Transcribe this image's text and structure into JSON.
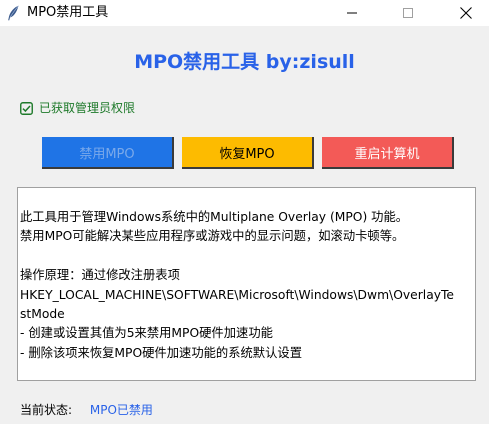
{
  "window": {
    "title": "MPO禁用工具"
  },
  "header": {
    "title": "MPO禁用工具 by:zisull"
  },
  "admin": {
    "status_text": "已获取管理员权限",
    "icon": "check-square-icon",
    "color": "#1e7a2a"
  },
  "buttons": {
    "disable_label": "禁用MPO",
    "restore_label": "恢复MPO",
    "reboot_label": "重启计算机",
    "disable_color": "#1f74e6",
    "restore_color": "#fdbb00",
    "reboot_color": "#f35a57"
  },
  "info": {
    "lines": [
      "此工具用于管理Windows系统中的Multiplane Overlay (MPO) 功能。",
      "禁用MPO可能解决某些应用程序或游戏中的显示问题，如滚动卡顿等。",
      "",
      "操作原理：通过修改注册表项",
      "HKEY_LOCAL_MACHINE\\SOFTWARE\\Microsoft\\Windows\\Dwm\\OverlayTe",
      "stMode",
      "- 创建或设置其值为5来禁用MPO硬件加速功能",
      "- 删除该项来恢复MPO硬件加速功能的系统默认设置"
    ]
  },
  "status": {
    "label": "当前状态:",
    "value": "MPO已禁用",
    "value_color": "#2962e8"
  }
}
